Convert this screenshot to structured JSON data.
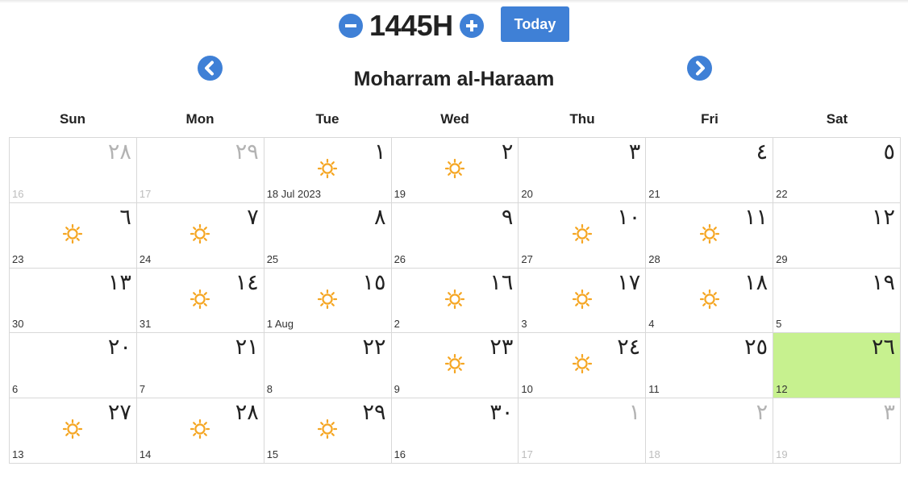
{
  "header": {
    "year": "1445H",
    "today_label": "Today",
    "month_name": "Moharram al-Haraam"
  },
  "weekdays": [
    "Sun",
    "Mon",
    "Tue",
    "Wed",
    "Thu",
    "Fri",
    "Sat"
  ],
  "colors": {
    "accent": "#3f80d6",
    "today_bg": "#c7f18f",
    "fast_icon": "#f5a623",
    "muted_text": "#b3b3b3"
  },
  "icons": {
    "decrement": "minus-circle-icon",
    "increment": "plus-circle-icon",
    "prev": "chevron-left-icon",
    "next": "chevron-right-icon",
    "day_marker": "sun-icon"
  },
  "days": [
    {
      "hijri": "٢٨",
      "greg": "16",
      "other": true,
      "sun": false
    },
    {
      "hijri": "٢٩",
      "greg": "17",
      "other": true,
      "sun": false
    },
    {
      "hijri": "١",
      "greg": "18 Jul 2023",
      "other": false,
      "sun": true
    },
    {
      "hijri": "٢",
      "greg": "19",
      "other": false,
      "sun": true
    },
    {
      "hijri": "٣",
      "greg": "20",
      "other": false,
      "sun": false
    },
    {
      "hijri": "٤",
      "greg": "21",
      "other": false,
      "sun": false
    },
    {
      "hijri": "٥",
      "greg": "22",
      "other": false,
      "sun": false
    },
    {
      "hijri": "٦",
      "greg": "23",
      "other": false,
      "sun": true
    },
    {
      "hijri": "٧",
      "greg": "24",
      "other": false,
      "sun": true
    },
    {
      "hijri": "٨",
      "greg": "25",
      "other": false,
      "sun": false
    },
    {
      "hijri": "٩",
      "greg": "26",
      "other": false,
      "sun": false
    },
    {
      "hijri": "١٠",
      "greg": "27",
      "other": false,
      "sun": true
    },
    {
      "hijri": "١١",
      "greg": "28",
      "other": false,
      "sun": true
    },
    {
      "hijri": "١٢",
      "greg": "29",
      "other": false,
      "sun": false
    },
    {
      "hijri": "١٣",
      "greg": "30",
      "other": false,
      "sun": false
    },
    {
      "hijri": "١٤",
      "greg": "31",
      "other": false,
      "sun": true
    },
    {
      "hijri": "١٥",
      "greg": "1 Aug",
      "other": false,
      "sun": true
    },
    {
      "hijri": "١٦",
      "greg": "2",
      "other": false,
      "sun": true
    },
    {
      "hijri": "١٧",
      "greg": "3",
      "other": false,
      "sun": true
    },
    {
      "hijri": "١٨",
      "greg": "4",
      "other": false,
      "sun": true
    },
    {
      "hijri": "١٩",
      "greg": "5",
      "other": false,
      "sun": false
    },
    {
      "hijri": "٢٠",
      "greg": "6",
      "other": false,
      "sun": false
    },
    {
      "hijri": "٢١",
      "greg": "7",
      "other": false,
      "sun": false
    },
    {
      "hijri": "٢٢",
      "greg": "8",
      "other": false,
      "sun": false
    },
    {
      "hijri": "٢٣",
      "greg": "9",
      "other": false,
      "sun": true
    },
    {
      "hijri": "٢٤",
      "greg": "10",
      "other": false,
      "sun": true
    },
    {
      "hijri": "٢٥",
      "greg": "11",
      "other": false,
      "sun": false
    },
    {
      "hijri": "٢٦",
      "greg": "12",
      "other": false,
      "sun": false,
      "today": true
    },
    {
      "hijri": "٢٧",
      "greg": "13",
      "other": false,
      "sun": true
    },
    {
      "hijri": "٢٨",
      "greg": "14",
      "other": false,
      "sun": true
    },
    {
      "hijri": "٢٩",
      "greg": "15",
      "other": false,
      "sun": true
    },
    {
      "hijri": "٣٠",
      "greg": "16",
      "other": false,
      "sun": false
    },
    {
      "hijri": "١",
      "greg": "17",
      "other": true,
      "sun": false
    },
    {
      "hijri": "٢",
      "greg": "18",
      "other": true,
      "sun": false
    },
    {
      "hijri": "٣",
      "greg": "19",
      "other": true,
      "sun": false
    }
  ]
}
